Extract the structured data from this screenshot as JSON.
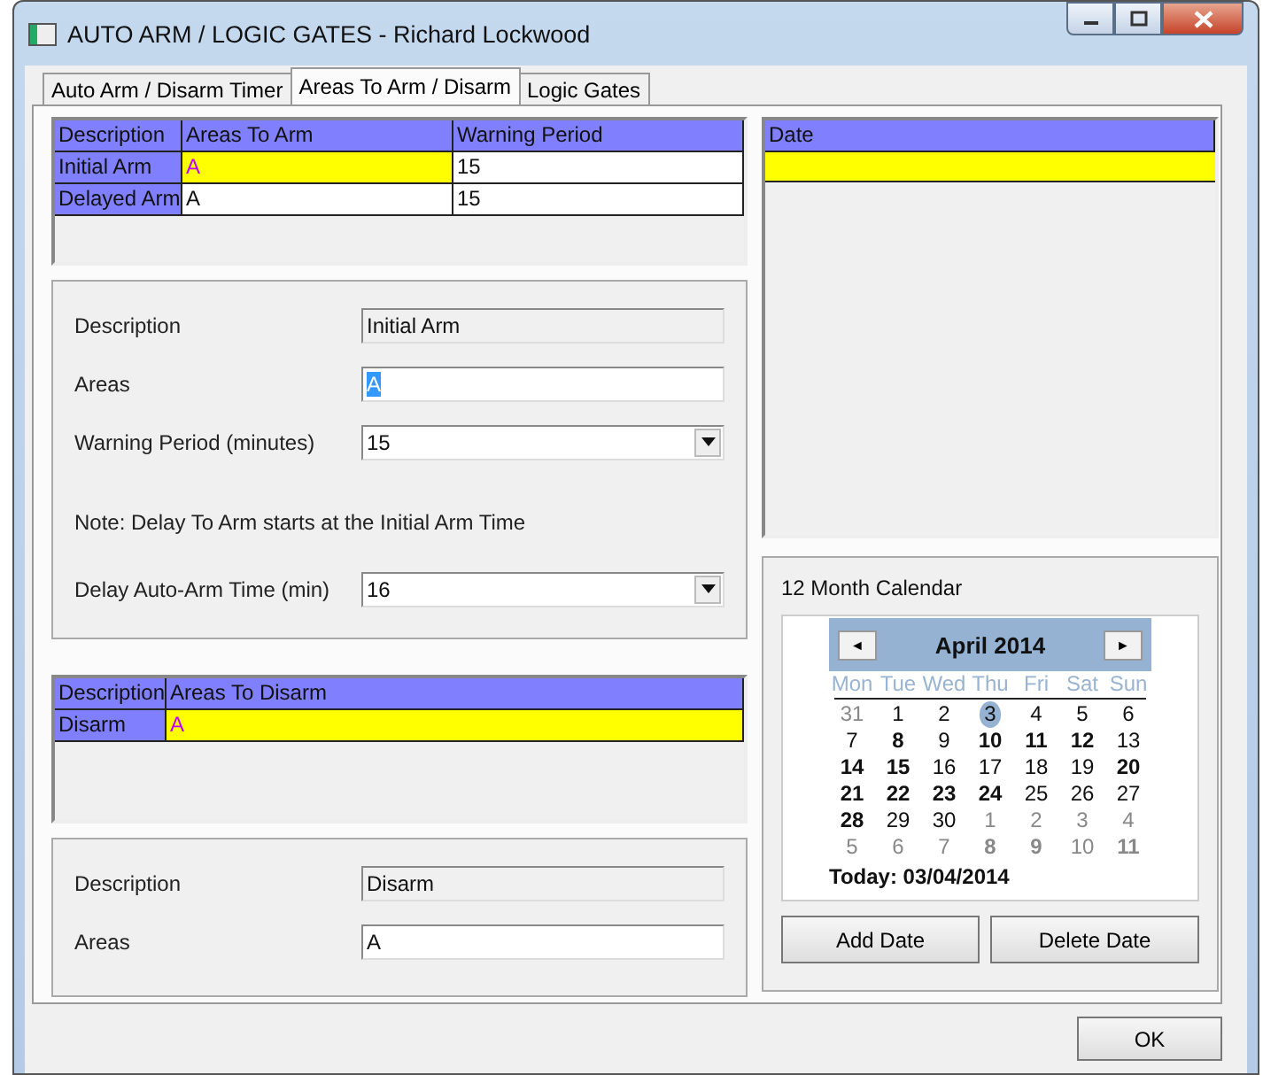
{
  "window": {
    "title": "AUTO ARM / LOGIC GATES - Richard Lockwood"
  },
  "tabs": [
    {
      "label": "Auto Arm / Disarm Timer",
      "selected": false
    },
    {
      "label": "Areas To Arm / Disarm",
      "selected": true
    },
    {
      "label": "Logic Gates",
      "selected": false
    }
  ],
  "arm_grid": {
    "columns": [
      "Description",
      "Areas To Arm",
      "Warning Period"
    ],
    "rows": [
      {
        "cells": [
          "Initial Arm",
          "A",
          "15"
        ],
        "selected": true
      },
      {
        "cells": [
          "Delayed Arm",
          "A",
          "15"
        ],
        "selected": false
      }
    ]
  },
  "arm_details": {
    "description_label": "Description",
    "description_value": "Initial Arm",
    "areas_label": "Areas",
    "areas_value": "A",
    "warning_label": "Warning Period (minutes)",
    "warning_value": "15",
    "note": "Note: Delay To Arm starts at the Initial Arm Time",
    "delay_label": "Delay Auto-Arm Time (min)",
    "delay_value": "16"
  },
  "disarm_grid": {
    "columns": [
      "Description",
      "Areas To Disarm"
    ],
    "rows": [
      {
        "cells": [
          "Disarm",
          "A"
        ],
        "selected": true
      }
    ]
  },
  "disarm_details": {
    "description_label": "Description",
    "description_value": "Disarm",
    "areas_label": "Areas",
    "areas_value": "A"
  },
  "date_grid": {
    "columns": [
      "Date"
    ],
    "rows": [
      {
        "selected": true
      }
    ]
  },
  "calendar": {
    "title": "12 Month Calendar",
    "month": "April 2014",
    "prev": "◄",
    "next": "►",
    "weekdays": [
      "Mon",
      "Tue",
      "Wed",
      "Thu",
      "Fri",
      "Sat",
      "Sun"
    ],
    "days": [
      {
        "text": "31",
        "other_month": true,
        "bold": false,
        "selected": false
      },
      {
        "text": "1",
        "other_month": false,
        "bold": false,
        "selected": false
      },
      {
        "text": "2",
        "other_month": false,
        "bold": false,
        "selected": false
      },
      {
        "text": "3",
        "other_month": false,
        "bold": false,
        "selected": true
      },
      {
        "text": "4",
        "other_month": false,
        "bold": false,
        "selected": false
      },
      {
        "text": "5",
        "other_month": false,
        "bold": false,
        "selected": false
      },
      {
        "text": "6",
        "other_month": false,
        "bold": false,
        "selected": false
      },
      {
        "text": "7",
        "other_month": false,
        "bold": false,
        "selected": false
      },
      {
        "text": "8",
        "other_month": false,
        "bold": true,
        "selected": false
      },
      {
        "text": "9",
        "other_month": false,
        "bold": false,
        "selected": false
      },
      {
        "text": "10",
        "other_month": false,
        "bold": true,
        "selected": false
      },
      {
        "text": "11",
        "other_month": false,
        "bold": true,
        "selected": false
      },
      {
        "text": "12",
        "other_month": false,
        "bold": true,
        "selected": false
      },
      {
        "text": "13",
        "other_month": false,
        "bold": false,
        "selected": false
      },
      {
        "text": "14",
        "other_month": false,
        "bold": true,
        "selected": false
      },
      {
        "text": "15",
        "other_month": false,
        "bold": true,
        "selected": false
      },
      {
        "text": "16",
        "other_month": false,
        "bold": false,
        "selected": false
      },
      {
        "text": "17",
        "other_month": false,
        "bold": false,
        "selected": false
      },
      {
        "text": "18",
        "other_month": false,
        "bold": false,
        "selected": false
      },
      {
        "text": "19",
        "other_month": false,
        "bold": false,
        "selected": false
      },
      {
        "text": "20",
        "other_month": false,
        "bold": true,
        "selected": false
      },
      {
        "text": "21",
        "other_month": false,
        "bold": true,
        "selected": false
      },
      {
        "text": "22",
        "other_month": false,
        "bold": true,
        "selected": false
      },
      {
        "text": "23",
        "other_month": false,
        "bold": true,
        "selected": false
      },
      {
        "text": "24",
        "other_month": false,
        "bold": true,
        "selected": false
      },
      {
        "text": "25",
        "other_month": false,
        "bold": false,
        "selected": false
      },
      {
        "text": "26",
        "other_month": false,
        "bold": false,
        "selected": false
      },
      {
        "text": "27",
        "other_month": false,
        "bold": false,
        "selected": false
      },
      {
        "text": "28",
        "other_month": false,
        "bold": true,
        "selected": false
      },
      {
        "text": "29",
        "other_month": false,
        "bold": false,
        "selected": false
      },
      {
        "text": "30",
        "other_month": false,
        "bold": false,
        "selected": false
      },
      {
        "text": "1",
        "other_month": true,
        "bold": false,
        "selected": false
      },
      {
        "text": "2",
        "other_month": true,
        "bold": false,
        "selected": false
      },
      {
        "text": "3",
        "other_month": true,
        "bold": false,
        "selected": false
      },
      {
        "text": "4",
        "other_month": true,
        "bold": false,
        "selected": false
      },
      {
        "text": "5",
        "other_month": true,
        "bold": false,
        "selected": false
      },
      {
        "text": "6",
        "other_month": true,
        "bold": false,
        "selected": false
      },
      {
        "text": "7",
        "other_month": true,
        "bold": false,
        "selected": false
      },
      {
        "text": "8",
        "other_month": true,
        "bold": true,
        "selected": false
      },
      {
        "text": "9",
        "other_month": true,
        "bold": true,
        "selected": false
      },
      {
        "text": "10",
        "other_month": true,
        "bold": false,
        "selected": false
      },
      {
        "text": "11",
        "other_month": true,
        "bold": true,
        "selected": false
      }
    ],
    "today": "Today: 03/04/2014"
  },
  "date_buttons": [
    "Add Date",
    "Delete Date"
  ],
  "footer_buttons": [
    "OK"
  ]
}
